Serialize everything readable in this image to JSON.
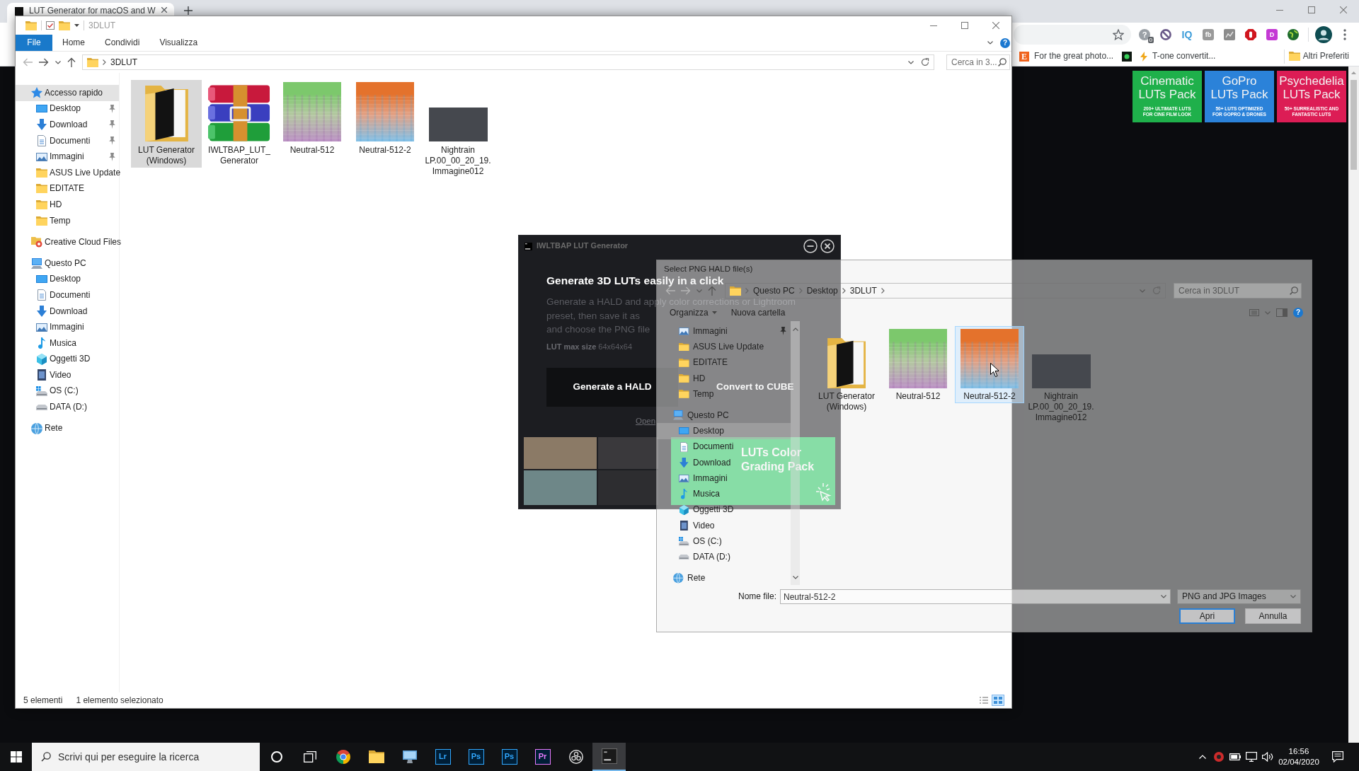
{
  "browser": {
    "tabs": [
      {
        "title": "LUT Generator for macOS and W",
        "selected": true
      }
    ],
    "extensions": [
      {
        "kind": "circle",
        "glyph": "?",
        "color": "#9aa0a6",
        "badge": "0"
      },
      {
        "kind": "ban"
      },
      {
        "kind": "text",
        "glyph": "IQ",
        "color": "#3a9bd9"
      },
      {
        "kind": "tile",
        "glyph": "fb",
        "color": "#9a9a9a"
      },
      {
        "kind": "chart"
      },
      {
        "kind": "hand"
      },
      {
        "kind": "tile",
        "glyph": "D",
        "color": "#c43ad4"
      },
      {
        "kind": "globe"
      }
    ],
    "bookmarks": [
      {
        "kind": "letter",
        "glyph": "E",
        "label": "For the great photo..."
      },
      {
        "kind": "image"
      },
      {
        "kind": "bolt",
        "label": "T-one convertit..."
      }
    ],
    "other_bookmarks": {
      "label": "Altri Preferiti"
    },
    "page": {
      "packs": [
        {
          "title": [
            "Cinematic",
            "LUTs Pack"
          ],
          "subtitle": [
            "200+ ULTIMATE LUTS",
            "FOR CINE FILM LOOK"
          ],
          "color": "#1fb04b"
        },
        {
          "title": [
            "GoPro",
            "LUTs Pack"
          ],
          "subtitle": [
            "50+ LUTS OPTIMIZED",
            "FOR GOPRO & DRONES"
          ],
          "color": "#2b82d9"
        },
        {
          "title": [
            "Psychedelia",
            "LUTs Pack"
          ],
          "subtitle": [
            "50+ SURREALISTIC AND",
            "FANTASTIC LUTS"
          ],
          "color": "#dc1d55"
        }
      ]
    }
  },
  "explorer": {
    "title": "3DLUT",
    "help": "?",
    "ribbon_tabs": [
      {
        "label": "File",
        "selected": true
      },
      {
        "label": "Home",
        "selected": false
      },
      {
        "label": "Condividi",
        "selected": false
      },
      {
        "label": "Visualizza",
        "selected": false
      }
    ],
    "path": [
      "3DLUT"
    ],
    "search": {
      "placeholder": "Cerca in 3..."
    },
    "sidebar": [
      {
        "label": "Accesso rapido",
        "kind": "star",
        "selected": true,
        "children": [
          {
            "label": "Desktop",
            "kind": "desktop",
            "pinned": true,
            "selected": false
          },
          {
            "label": "Download",
            "kind": "download",
            "pinned": true,
            "selected": false
          },
          {
            "label": "Documenti",
            "kind": "document",
            "pinned": true,
            "selected": false
          },
          {
            "label": "Immagini",
            "kind": "pictures",
            "pinned": true,
            "selected": false
          },
          {
            "label": "ASUS Live Update",
            "kind": "folder",
            "pinned": false,
            "selected": false
          },
          {
            "label": "EDITATE",
            "kind": "folder",
            "pinned": false,
            "selected": false
          },
          {
            "label": "HD",
            "kind": "folder",
            "pinned": false,
            "selected": false
          },
          {
            "label": "Temp",
            "kind": "folder",
            "pinned": false,
            "selected": false
          }
        ]
      },
      {
        "label": "Creative Cloud Files",
        "kind": "cloud",
        "selected": false
      },
      {
        "label": "Questo PC",
        "kind": "pc",
        "selected": false,
        "children": [
          {
            "label": "Desktop",
            "kind": "desktop",
            "selected": false
          },
          {
            "label": "Documenti",
            "kind": "document",
            "selected": false
          },
          {
            "label": "Download",
            "kind": "download",
            "selected": false
          },
          {
            "label": "Immagini",
            "kind": "pictures",
            "selected": false
          },
          {
            "label": "Musica",
            "kind": "music",
            "selected": false
          },
          {
            "label": "Oggetti 3D",
            "kind": "cube",
            "selected": false
          },
          {
            "label": "Video",
            "kind": "video",
            "selected": false
          },
          {
            "label": "OS (C:)",
            "kind": "osdrive",
            "selected": false
          },
          {
            "label": "DATA (D:)",
            "kind": "drive",
            "selected": false
          }
        ]
      },
      {
        "label": "Rete",
        "kind": "network",
        "selected": false
      }
    ],
    "files": [
      {
        "name": "LUT Generator (Windows)",
        "kind": "appfolder",
        "selected": true
      },
      {
        "name": "IWLTBAP_LUT_Generator",
        "kind": "archive",
        "selected": false
      },
      {
        "name": "Neutral-512",
        "kind": "grid",
        "color": "#7cc86c",
        "selected": false
      },
      {
        "name": "Neutral-512-2",
        "kind": "grid",
        "color": "#e4722c",
        "selected": false
      },
      {
        "name": "Nightrain LP.00_00_20_19.Immagine012",
        "kind": "photo",
        "selected": false
      }
    ],
    "status": {
      "count": "5 elementi",
      "selection": "1 elemento selezionato"
    },
    "views": [
      {
        "kind": "details",
        "selected": false
      },
      {
        "kind": "icons",
        "selected": true
      }
    ]
  },
  "lut_app": {
    "title": "IWLTBAP LUT Generator",
    "heading": "Generate 3D LUTs easily in a click",
    "description": [
      "Generate a HALD and apply color corrections or Lightroom",
      "preset, then save it as",
      "and choose the PNG file"
    ],
    "limits": "**LUT max size** 64x64x64",
    "buttons": [
      {
        "label": "Generate a HALD",
        "kind": "dark"
      },
      {
        "label": "Convert to CUBE",
        "kind": "plain"
      }
    ],
    "link": "Open",
    "promo": {
      "title": "LUTs Color Grading Pack"
    }
  },
  "file_dialog": {
    "title": "Select PNG HALD file(s)",
    "help": "?",
    "path": [
      "Questo PC",
      "Desktop",
      "3DLUT"
    ],
    "search": {
      "placeholder": "Cerca in 3DLUT"
    },
    "toolbar": [
      {
        "label": "Organizza",
        "kind": "menu"
      },
      {
        "label": "Nuova cartella",
        "kind": "button"
      }
    ],
    "nav": [
      {
        "children": [
          {
            "label": "Immagini",
            "kind": "pictures",
            "pinned": true,
            "selected": false
          },
          {
            "label": "ASUS Live Update",
            "kind": "folder",
            "pinned": false,
            "selected": false
          },
          {
            "label": "EDITATE",
            "kind": "folder",
            "pinned": false,
            "selected": false
          },
          {
            "label": "HD",
            "kind": "folder",
            "pinned": false,
            "selected": false
          },
          {
            "label": "Temp",
            "kind": "folder",
            "pinned": false,
            "selected": false
          }
        ]
      },
      {
        "label": "Questo PC",
        "kind": "pc",
        "selected": false,
        "children": [
          {
            "label": "Desktop",
            "kind": "desktop",
            "selected": true
          },
          {
            "label": "Documenti",
            "kind": "document",
            "selected": false
          },
          {
            "label": "Download",
            "kind": "download",
            "selected": false
          },
          {
            "label": "Immagini",
            "kind": "pictures",
            "selected": false
          },
          {
            "label": "Musica",
            "kind": "music",
            "selected": false
          },
          {
            "label": "Oggetti 3D",
            "kind": "cube",
            "selected": false
          },
          {
            "label": "Video",
            "kind": "video",
            "selected": false
          },
          {
            "label": "OS (C:)",
            "kind": "osdrive",
            "selected": false
          },
          {
            "label": "DATA (D:)",
            "kind": "drive",
            "selected": false
          }
        ]
      },
      {
        "label": "Rete",
        "kind": "network",
        "selected": false
      }
    ],
    "files": [
      {
        "name": "LUT Generator (Windows)",
        "kind": "appfolder",
        "selected": false
      },
      {
        "name": "Neutral-512",
        "kind": "grid",
        "color": "#7cc86c",
        "selected": false
      },
      {
        "name": "Neutral-512-2",
        "kind": "grid",
        "color": "#e4722c",
        "selected": true
      },
      {
        "name": "Nightrain LP.00_00_20_19.Immagine012",
        "kind": "photo",
        "selected": false
      }
    ],
    "filename": {
      "label": "Nome file:",
      "value": "Neutral-512-2"
    },
    "filetype": {
      "value": "PNG and JPG Images"
    },
    "buttons": [
      {
        "label": "Apri",
        "kind": "default"
      },
      {
        "label": "Annulla",
        "kind": "normal"
      }
    ]
  },
  "taskbar": {
    "search": {
      "placeholder": "Scrivi qui per eseguire la ricerca"
    },
    "apps": [
      {
        "kind": "cortana",
        "selected": false
      },
      {
        "kind": "taskview",
        "selected": false
      },
      {
        "kind": "chrome",
        "selected": false
      },
      {
        "kind": "explorer",
        "selected": false
      },
      {
        "kind": "remote",
        "selected": false
      },
      {
        "kind": "tile",
        "glyph": "Lr",
        "color": "#31a8ff",
        "selected": false
      },
      {
        "kind": "tile",
        "glyph": "Ps",
        "color": "#31a8ff",
        "selected": false
      },
      {
        "kind": "tile",
        "glyph": "Ps",
        "color": "#31a8ff",
        "selected": false
      },
      {
        "kind": "tile",
        "glyph": "Pr",
        "color": "#e77bff",
        "selected": false
      },
      {
        "kind": "obs",
        "selected": false
      },
      {
        "kind": "lut",
        "selected": true
      }
    ],
    "tray": [
      {
        "kind": "chevron"
      },
      {
        "kind": "record"
      },
      {
        "kind": "battery"
      },
      {
        "kind": "network"
      },
      {
        "kind": "volume"
      }
    ],
    "clock": {
      "time": "16:56",
      "date": "02/04/2020"
    }
  }
}
